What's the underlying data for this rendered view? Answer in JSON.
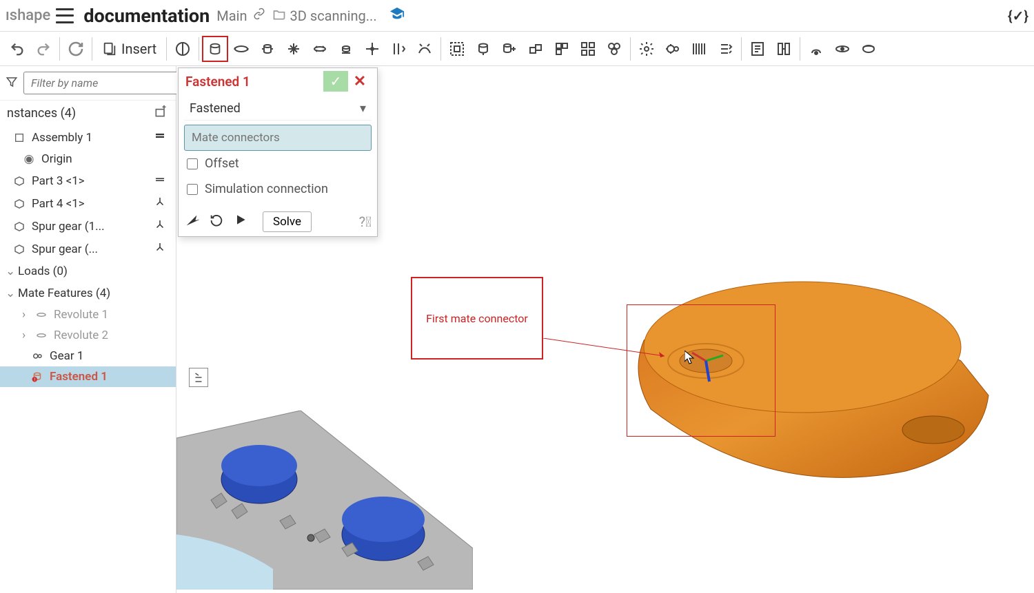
{
  "header": {
    "logo": "ıshape",
    "doc_title": "documentation",
    "branch": "Main",
    "folder_path": "3D scanning..."
  },
  "toolbar": {
    "insert_label": "Insert",
    "json_glyph": "{✓}"
  },
  "left_panel": {
    "filter_placeholder": "Filter by name",
    "instances_header": "nstances (4)",
    "tree": {
      "assembly": "Assembly 1",
      "origin": "Origin",
      "part3": "Part 3 <1>",
      "part4": "Part 4 <1>",
      "spur1": "Spur gear (1...",
      "spur2": "Spur gear (...",
      "loads": "Loads (0)",
      "mate_features": "Mate Features (4)",
      "rev1": "Revolute 1",
      "rev2": "Revolute 2",
      "gear1": "Gear 1",
      "fastened1": "Fastened 1"
    }
  },
  "dialog": {
    "title": "Fastened 1",
    "type_label": "Fastened",
    "input_placeholder": "Mate connectors",
    "offset_label": "Offset",
    "sim_label": "Simulation connection",
    "solve_label": "Solve"
  },
  "canvas": {
    "callout": "First mate connector"
  }
}
